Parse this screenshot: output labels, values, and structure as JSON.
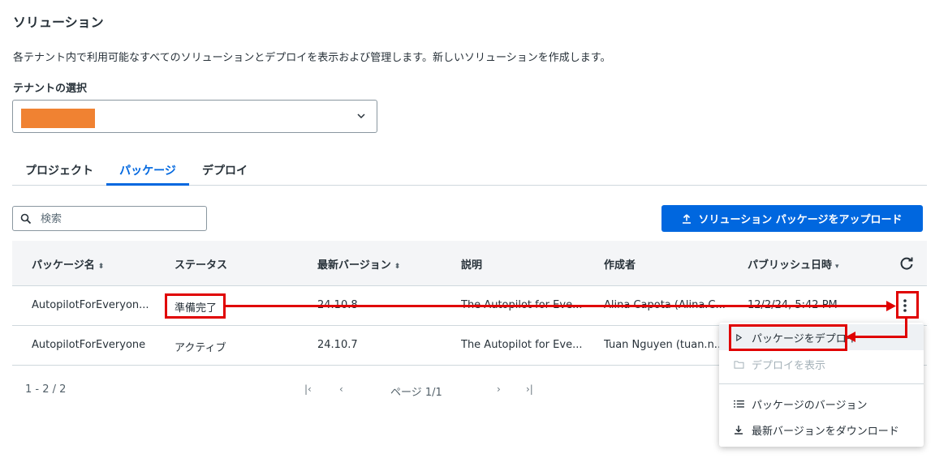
{
  "page": {
    "title": "ソリューション",
    "description": "各テナント内で利用可能なすべてのソリューションとデプロイを表示および管理します。新しいソリューションを作成します。"
  },
  "tenant": {
    "label": "テナントの選択",
    "redacted_color": "#f08232"
  },
  "tabs": [
    {
      "label": "プロジェクト",
      "active": false
    },
    {
      "label": "パッケージ",
      "active": true
    },
    {
      "label": "デプロイ",
      "active": false
    }
  ],
  "search": {
    "placeholder": "検索"
  },
  "upload_button": {
    "label": "ソリューション パッケージをアップロード"
  },
  "table": {
    "columns": [
      {
        "label": "パッケージ名",
        "sort": "⬍"
      },
      {
        "label": "ステータス",
        "sort": ""
      },
      {
        "label": "最新バージョン",
        "sort": "⬍"
      },
      {
        "label": "説明",
        "sort": ""
      },
      {
        "label": "作成者",
        "sort": ""
      },
      {
        "label": "パブリッシュ日時",
        "sort": "▾"
      }
    ],
    "rows": [
      {
        "name": "AutopilotForEveryon...",
        "status": "準備完了",
        "version": "24.10.8",
        "description": "The Autopilot for Eve...",
        "author": "Alina Capota (Alina.C...",
        "published": "12/2/24, 5:42 PM"
      },
      {
        "name": "AutopilotForEveryone",
        "status": "アクティブ",
        "version": "24.10.7",
        "description": "The Autopilot for Eve...",
        "author": "Tuan Nguyen (tuan.n...",
        "published": ""
      }
    ]
  },
  "pager": {
    "range": "1 - 2 / 2",
    "page_label": "ページ 1/1",
    "first": "|‹",
    "prev": "‹",
    "next": "›",
    "last": "›|"
  },
  "context_menu": {
    "items": [
      {
        "label": "パッケージをデプロイ",
        "icon": "play-icon",
        "disabled": false
      },
      {
        "label": "デプロイを表示",
        "icon": "folder-icon",
        "disabled": true
      },
      {
        "label": "パッケージのバージョン",
        "icon": "list-icon",
        "disabled": false
      },
      {
        "label": "最新バージョンをダウンロード",
        "icon": "download-icon",
        "disabled": false
      }
    ]
  },
  "colors": {
    "accent": "#0067df",
    "highlight": "#e00000"
  }
}
